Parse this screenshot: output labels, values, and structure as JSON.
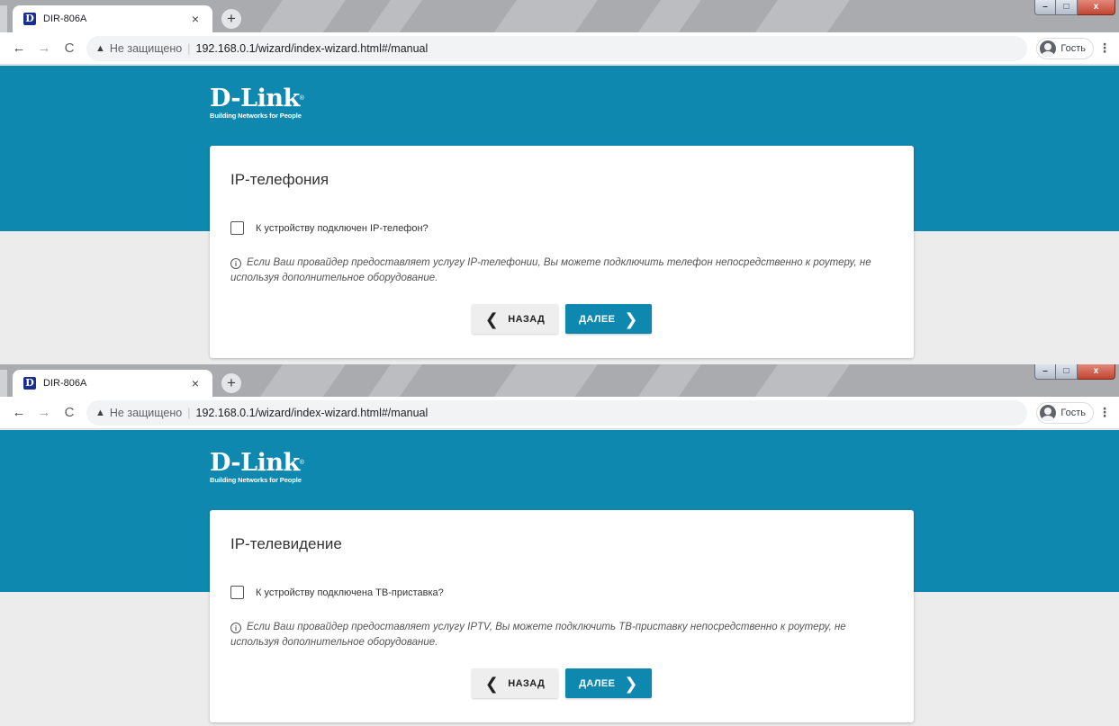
{
  "colors": {
    "accent": "#0f88b0",
    "card": "#ffffff",
    "page_bg": "#ececec"
  },
  "icons": {
    "favicon": "d-link-favicon",
    "info": "info-circle-icon",
    "back": "chevron-left-icon",
    "next": "chevron-right-icon"
  },
  "browser": {
    "tab_favicon": "D",
    "tab_title": "DIR-806A",
    "tab_close": "×",
    "new_tab": "+",
    "back": "←",
    "forward": "→",
    "reload": "C",
    "insecure": "Не защищено",
    "separator": "|",
    "url": "192.168.0.1/wizard/index-wizard.html#/manual",
    "profile": "Гость",
    "menu": "⋮",
    "win_min": "–",
    "win_max": "□",
    "win_close": "x"
  },
  "logo": {
    "main": "D-Link",
    "tm": "®",
    "tagline": "Building Networks for People"
  },
  "screens": [
    {
      "title": "IP-телефония",
      "checkbox_label": "К устройству подключен IP-телефон?",
      "info_text": "Если Ваш провайдер предоставляет услугу IP-телефонии, Вы можете подключить телефон непосредственно к роутеру, не используя дополнительное оборудование.",
      "back_label": "НАЗАД",
      "next_label": "ДАЛЕЕ"
    },
    {
      "title": "IP-телевидение",
      "checkbox_label": "К устройству подключена ТВ-приставка?",
      "info_text": "Если Ваш провайдер предоставляет услугу IPTV, Вы можете подключить ТВ-приставку непосредственно к роутеру, не используя дополнительное оборудование.",
      "back_label": "НАЗАД",
      "next_label": "ДАЛЕЕ"
    }
  ]
}
